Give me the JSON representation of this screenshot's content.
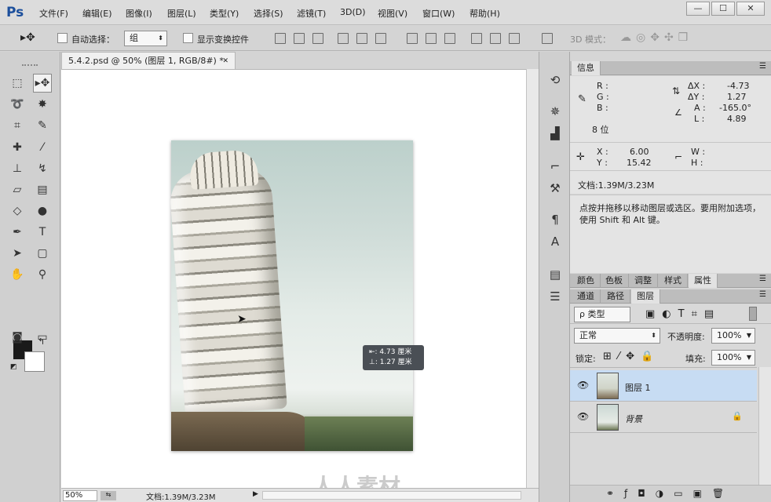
{
  "app": {
    "logo": "Ps",
    "menus": [
      "文件(F)",
      "编辑(E)",
      "图像(I)",
      "图层(L)",
      "类型(Y)",
      "选择(S)",
      "滤镜(T)",
      "3D(D)",
      "视图(V)",
      "窗口(W)",
      "帮助(H)"
    ],
    "window_buttons": [
      "—",
      "☐",
      "✕"
    ]
  },
  "options": {
    "auto_select_label": "自动选择：",
    "auto_select_value": "组",
    "transform_label": "显示变换控件",
    "mode3d_label": "3D 模式："
  },
  "document": {
    "tab_title": "5.4.2.psd @ 50% (图层 1, RGB/8#) *",
    "close": "✕",
    "zoom": "50%",
    "status": "文档:1.39M/3.23M"
  },
  "canvas": {
    "tooltip_line1": "⇤: 4.73 厘米",
    "tooltip_line2": "⊥: 1.27 厘米",
    "watermark": "人人素材"
  },
  "info_panel": {
    "tab": "信息",
    "r": "R :",
    "g": "G :",
    "b": "B :",
    "bits": "8 位",
    "dx_label": "ΔX :",
    "dx": "-4.73",
    "dy_label": "ΔY :",
    "dy": "1.27",
    "a_label": "A :",
    "a": "-165.0°",
    "l_label": "L :",
    "l": "4.89",
    "x_label": "X :",
    "x": "6.00",
    "y_label": "Y :",
    "y": "15.42",
    "w": "W :",
    "h": "H :",
    "doc": "文档:1.39M/3.23M",
    "hint": "点按并拖移以移动图层或选区。要用附加选项，使用 Shift 和 Alt 键。"
  },
  "adjust_tabs": [
    "颜色",
    "色板",
    "调整",
    "样式",
    "属性"
  ],
  "layers_panel": {
    "tabs": [
      "通道",
      "路径",
      "图层"
    ],
    "filter": "ρ 类型",
    "blend": "正常",
    "opacity_label": "不透明度:",
    "opacity": "100%",
    "lock_label": "锁定:",
    "fill_label": "填充:",
    "fill": "100%",
    "layers": [
      {
        "name": "图层 1",
        "selected": true
      },
      {
        "name": "背景",
        "selected": false
      }
    ]
  }
}
